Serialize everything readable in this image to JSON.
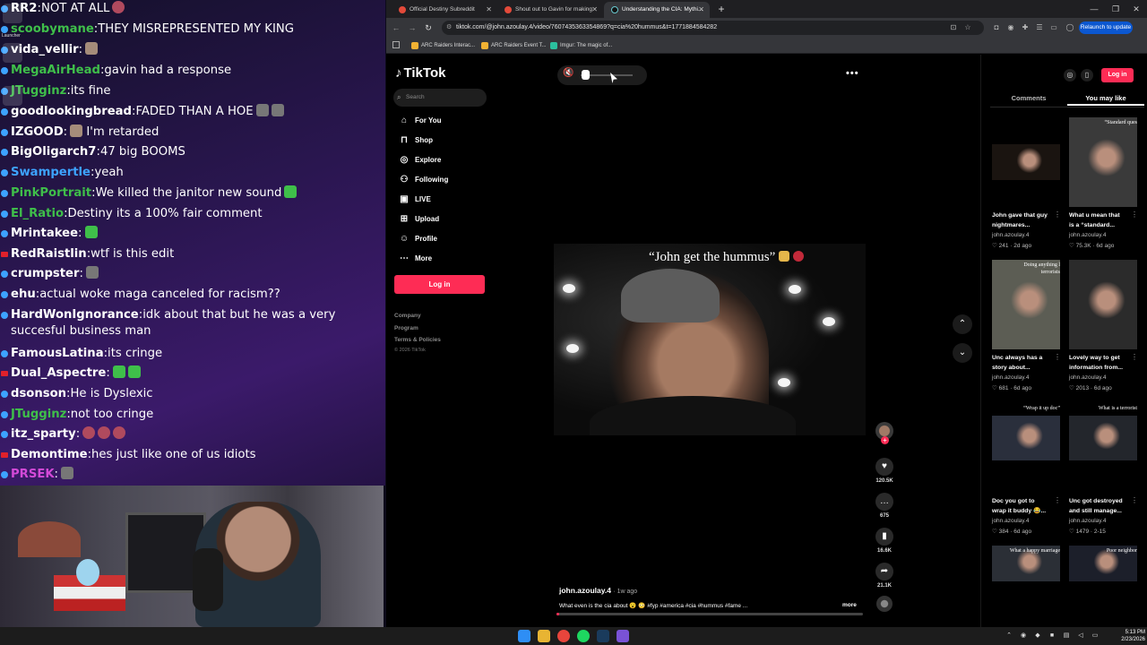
{
  "chat": {
    "messages": [
      {
        "user": "RR2",
        "user_color": "#ffffff",
        "text": "NOT AT ALL",
        "emotes": [
          "ball"
        ],
        "bullet": "blue"
      },
      {
        "user": "scoobymane",
        "user_color": "#3fbf4a",
        "text": "THEY MISREPRESENTED MY KING",
        "emotes": [],
        "bullet": "blue"
      },
      {
        "user": "vida_vellir",
        "user_color": "#ffffff",
        "text": "",
        "emotes": [
          "face"
        ],
        "bullet": "blue"
      },
      {
        "user": "MegaAirHead",
        "user_color": "#3fbf4a",
        "text": "gavin had a response",
        "emotes": [],
        "bullet": "blue"
      },
      {
        "user": "JTugginz",
        "user_color": "#3fbf4a",
        "text": "its fine",
        "emotes": [],
        "bullet": "blue"
      },
      {
        "user": "goodlookingbread",
        "user_color": "#ffffff",
        "text": "FADED THAN A HOE",
        "emotes": [
          "rock",
          "rock"
        ],
        "bullet": "blue"
      },
      {
        "user": "IZGOOD",
        "user_color": "#ffffff",
        "text": " I'm retarded",
        "emotes_before": [
          "face"
        ],
        "emotes": [],
        "bullet": "blue"
      },
      {
        "user": "BigOligarch7",
        "user_color": "#ffffff",
        "text": "47 big BOOMS",
        "emotes": [],
        "bullet": "blue"
      },
      {
        "user": "Swampertle",
        "user_color": "#3da3ff",
        "text": "yeah",
        "emotes": [],
        "bullet": "blue"
      },
      {
        "user": "PinkPortrait",
        "user_color": "#3fbf4a",
        "text": "We killed the janitor new sound",
        "emotes": [
          "green"
        ],
        "bullet": "blue"
      },
      {
        "user": "El_Ratio",
        "user_color": "#3fbf4a",
        "text": "Destiny its a 100% fair comment",
        "emotes": [],
        "bullet": "blue"
      },
      {
        "user": "Mrintakee",
        "user_color": "#ffffff",
        "text": "",
        "emotes": [
          "green"
        ],
        "bullet": "blue"
      },
      {
        "user": "RedRaistlin",
        "user_color": "#ffffff",
        "text": "wtf is this edit",
        "emotes": [],
        "bullet": "red"
      },
      {
        "user": "crumpster",
        "user_color": "#ffffff",
        "text": "",
        "emotes": [
          "rock"
        ],
        "bullet": "blue"
      },
      {
        "user": "ehu",
        "user_color": "#ffffff",
        "text": "actual woke maga canceled for racism??",
        "emotes": [],
        "bullet": "blue"
      },
      {
        "user": "HardWonIgnorance",
        "user_color": "#ffffff",
        "text": "idk about that but he was a very succesful business man",
        "emotes": [],
        "bullet": "blue",
        "wrap": true
      },
      {
        "user": "FamousLatina",
        "user_color": "#ffffff",
        "text": "its cringe",
        "emotes": [],
        "bullet": "blue"
      },
      {
        "user": "Dual_Aspectre",
        "user_color": "#ffffff",
        "text": "",
        "emotes": [
          "green",
          "green"
        ],
        "bullet": "red"
      },
      {
        "user": "dsonson",
        "user_color": "#ffffff",
        "text": "He is Dyslexic",
        "emotes": [],
        "bullet": "blue"
      },
      {
        "user": "JTugginz",
        "user_color": "#3fbf4a",
        "text": "not too cringe",
        "emotes": [],
        "bullet": "blue"
      },
      {
        "user": "itz_sparty",
        "user_color": "#ffffff",
        "text": "",
        "emotes": [
          "ball",
          "ball",
          "ball"
        ],
        "bullet": "blue"
      },
      {
        "user": "Demontime",
        "user_color": "#ffffff",
        "text": "hes just like one of us idiots",
        "emotes": [],
        "bullet": "red"
      },
      {
        "user": "PRSEK",
        "user_color": "#d34ad8",
        "text": "",
        "emotes": [
          "rock"
        ],
        "bullet": "blue"
      }
    ]
  },
  "desktop": {
    "launcher_label": "Launcher"
  },
  "browser": {
    "tabs": [
      {
        "title": "Official Destiny Subreddit",
        "active": false
      },
      {
        "title": "Shout out to Gavin for making",
        "active": false
      },
      {
        "title": "Understanding the CIA: Mythi...",
        "active": true
      }
    ],
    "url": "tiktok.com/@john.azoulay.4/video/7607435363354869?q=cia%20hummus&t=1771884584282",
    "relaunch_label": "Relaunch to update",
    "bookmarks": [
      "ARC Raiders Interac...",
      "ARC Raiders Event T...",
      "Imgur: The magic of..."
    ]
  },
  "tiktok": {
    "logo": "TikTok",
    "search_placeholder": "Search",
    "nav": [
      {
        "label": "For You",
        "icon": "home-icon"
      },
      {
        "label": "Shop",
        "icon": "shop-icon"
      },
      {
        "label": "Explore",
        "icon": "compass-icon"
      },
      {
        "label": "Following",
        "icon": "following-icon"
      },
      {
        "label": "LIVE",
        "icon": "live-icon"
      },
      {
        "label": "Upload",
        "icon": "upload-icon"
      },
      {
        "label": "Profile",
        "icon": "profile-icon"
      },
      {
        "label": "More",
        "icon": "more-icon"
      }
    ],
    "login_label": "Log in",
    "footer_links": [
      "Company",
      "Program",
      "Terms & Policies"
    ],
    "copyright": "© 2026 TikTok",
    "volume_level": 0.05,
    "video_caption": "“John get the hummus”",
    "actions": {
      "likes": "120.5K",
      "comments": "675",
      "saves": "16.6K",
      "shares": "21.1K"
    },
    "author": "john.azoulay.4",
    "posted": "1w ago",
    "description": "What even is the cia about 😮 😳 #fyp #america #cia #hummus #fame ...",
    "more_label": "more",
    "progress": 0.01,
    "right_panel": {
      "login_label": "Log in",
      "tabs": [
        {
          "label": "Comments",
          "active": false
        },
        {
          "label": "You may like",
          "active": true
        }
      ],
      "videos": [
        {
          "title": "John gave that guy nightmares...",
          "author": "john.azoulay.4",
          "likes": "241",
          "date": "2d ago",
          "overlay": ""
        },
        {
          "title": "What u mean that is a “standard...",
          "author": "john.azoulay.4",
          "likes": "75.3K",
          "date": "6d ago",
          "overlay": "“Standard ques"
        },
        {
          "title": "Unc always has a story about...",
          "author": "john.azoulay.4",
          "likes": "681",
          "date": "6d ago",
          "overlay": "Doing anything l terrorists"
        },
        {
          "title": "Lovely way to get information from...",
          "author": "john.azoulay.4",
          "likes": "2013",
          "date": "6d ago",
          "overlay": ""
        },
        {
          "title": "Doc you got to wrap it buddy 😂...",
          "author": "john.azoulay.4",
          "likes": "384",
          "date": "6d ago",
          "overlay": "“Wrap it up doc”"
        },
        {
          "title": "Unc got destroyed and still manage...",
          "author": "john.azoulay.4",
          "likes": "1479",
          "date": "2-15",
          "overlay": "What is a terrorist"
        },
        {
          "title": "",
          "author": "",
          "likes": "",
          "date": "",
          "overlay": "What a happy marriage"
        },
        {
          "title": "",
          "author": "",
          "likes": "",
          "date": "",
          "overlay": "Poor neighbor"
        }
      ]
    }
  },
  "taskbar": {
    "time": "5:13 PM",
    "date": "2/23/2026"
  }
}
